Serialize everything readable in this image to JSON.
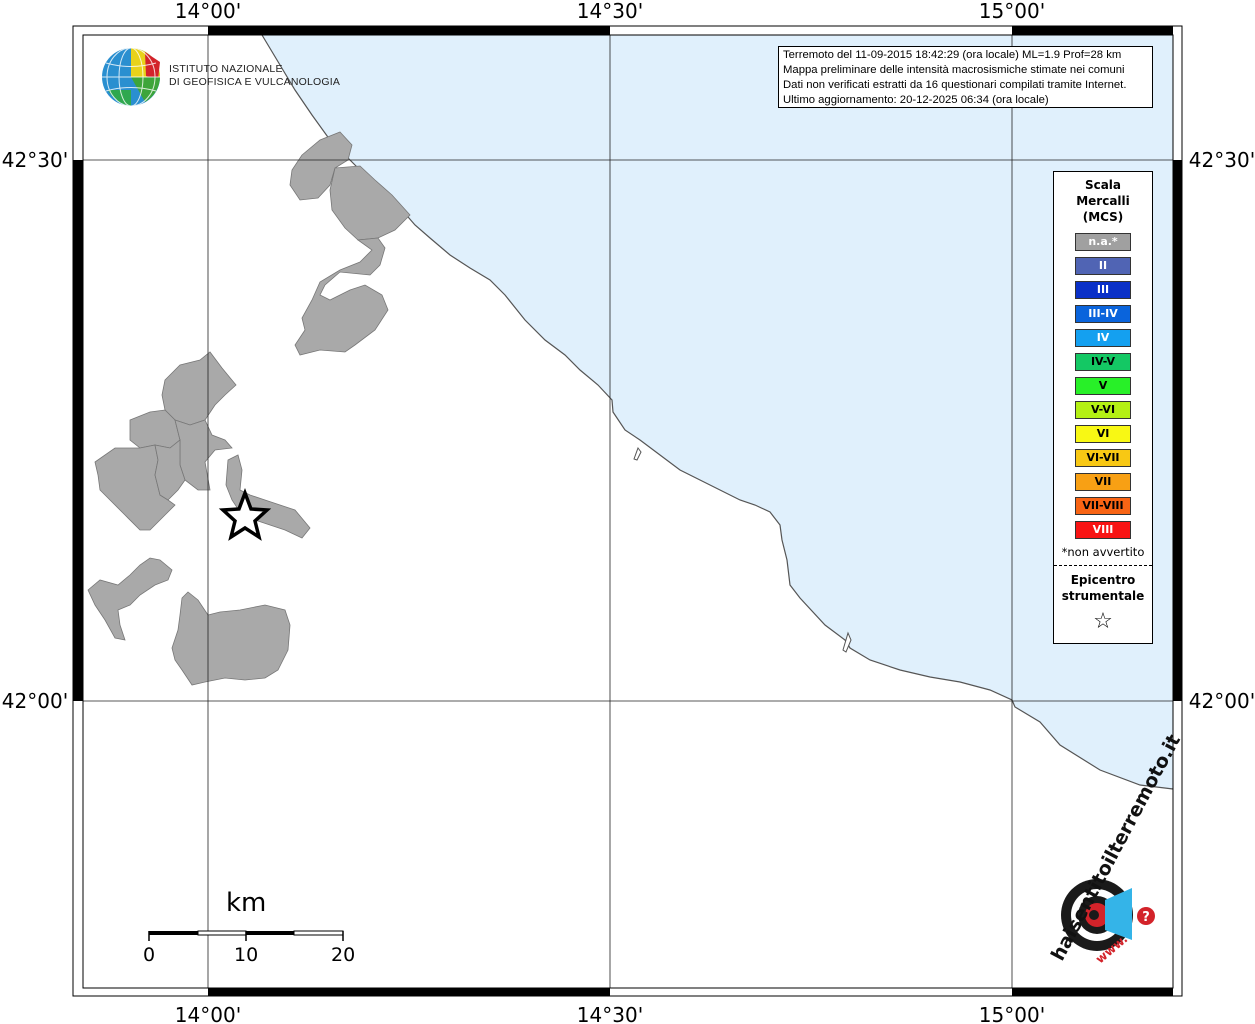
{
  "info": {
    "line1": "Terremoto del 11-09-2015 18:42:29 (ora locale) ML=1.9 Prof=28 km",
    "line2": "Mappa preliminare delle intensità macrosismiche stimate nei comuni",
    "line3": "Dati non verificati estratti da 16 questionari compilati tramite Internet.",
    "line4": "Ultimo aggiornamento: 20-12-2025 06:34 (ora locale)"
  },
  "coords": {
    "top": [
      "14°00'",
      "14°30'",
      "15°00'"
    ],
    "bottom": [
      "14°00'",
      "14°30'",
      "15°00'"
    ],
    "left": [
      "42°30'",
      "42°00'"
    ],
    "right": [
      "42°30'",
      "42°00'"
    ]
  },
  "logo": {
    "ingv_line1": "ISTITUTO NAZIONALE",
    "ingv_line2": "DI GEOFISICA E VULCANOLOGIA",
    "hsit_text": "haisentitoilterremoto.it",
    "hsit_www": "www.",
    "hsit_q": "?"
  },
  "legend": {
    "title1": "Scala",
    "title2": "Mercalli",
    "title3": "(MCS)",
    "items": [
      {
        "label": "n.a.*",
        "color": "#a0a0a0",
        "light": true
      },
      {
        "label": "II",
        "color": "#5064b4",
        "light": true
      },
      {
        "label": "III",
        "color": "#0a30c8",
        "light": true
      },
      {
        "label": "III-IV",
        "color": "#0a64dc",
        "light": true
      },
      {
        "label": "IV",
        "color": "#14a0f0",
        "light": true
      },
      {
        "label": "IV-V",
        "color": "#14c864",
        "light": false
      },
      {
        "label": "V",
        "color": "#28f028",
        "light": false
      },
      {
        "label": "V-VI",
        "color": "#b4f014",
        "light": false
      },
      {
        "label": "VI",
        "color": "#f8f814",
        "light": false
      },
      {
        "label": "VI-VII",
        "color": "#f8c814",
        "light": false
      },
      {
        "label": "VII",
        "color": "#f8a014",
        "light": false
      },
      {
        "label": "VII-VIII",
        "color": "#f86414",
        "light": false
      },
      {
        "label": "VIII",
        "color": "#f81414",
        "light": true
      }
    ],
    "note": "*non avvertito",
    "epi1": "Epicentro",
    "epi2": "strumentale",
    "star": "☆"
  },
  "scale": {
    "unit": "km",
    "ticks": [
      "0",
      "10",
      "20"
    ]
  },
  "colors": {
    "sea": "#e0f0fc",
    "municipality": "#a9a9a9",
    "coastline": "#555555"
  }
}
